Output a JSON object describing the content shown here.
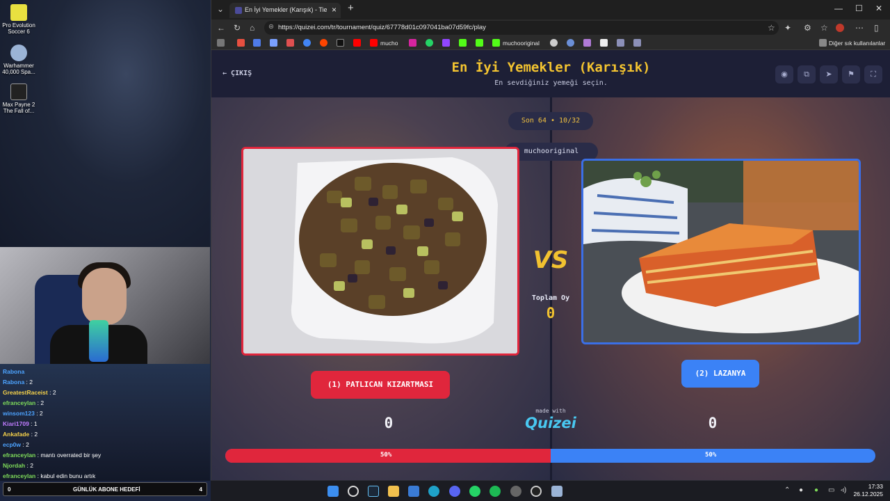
{
  "desktop": {
    "icons": [
      {
        "label": "Pro Evolution Soccer 6",
        "icon": "pes6-icon"
      },
      {
        "label": "Warhammer 40,000 Spa...",
        "icon": "warhammer-icon"
      },
      {
        "label": "Max Payne 2 The Fall of...",
        "icon": "maxpayne-icon"
      }
    ]
  },
  "chat": {
    "lines": [
      {
        "user": "Rabona",
        "msg": "",
        "color": "#4da3ff"
      },
      {
        "user": "Rabona",
        "msg": " : 2",
        "color": "#4da3ff"
      },
      {
        "user": "GreatestRaceist",
        "msg": " : 2",
        "color": "#f5d14a"
      },
      {
        "user": "efranceylan",
        "msg": " : 2",
        "color": "#7fdc5a"
      },
      {
        "user": "winsom123",
        "msg": " : 2",
        "color": "#4da3ff"
      },
      {
        "user": "Kiari1709",
        "msg": " : 1",
        "color": "#c07cff"
      },
      {
        "user": "Ankafade",
        "msg": " : 2",
        "color": "#f5d14a"
      },
      {
        "user": "ecp0w",
        "msg": " : 2",
        "color": "#4da3ff"
      },
      {
        "user": "efranceylan",
        "msg": " : mantı overrated bir şey",
        "color": "#7fdc5a"
      },
      {
        "user": "Njordah",
        "msg": " : 2",
        "color": "#7fdc5a"
      },
      {
        "user": "efranceylan",
        "msg": " : kabul edin bunu artık",
        "color": "#7fdc5a"
      }
    ],
    "goal": {
      "left": "0",
      "label": "GÜNLÜK ABONE HEDEFİ",
      "right": "4"
    }
  },
  "browser": {
    "tab_title": "En İyi Yemekler (Karışık) - Tier List",
    "url": "https://quizei.com/tr/tournament/quiz/67778d01c097041ba07d59fc/play",
    "bookmarks": {
      "mucho": "mucho",
      "muchooriginal": "muchooriginal",
      "other": "Diğer sık kullanılanlar"
    }
  },
  "quiz": {
    "back": "ÇIKIŞ",
    "title": "En İyi Yemekler (Karışık)",
    "subtitle": "En sevdiğiniz yemeği seçin.",
    "round": "Son 64 • 10/32",
    "user": "muchooriginal",
    "vs": "VS",
    "total_label": "Toplam Oy",
    "total_value": "0",
    "left": {
      "label": "(1) PATLICAN KIZARTMASI",
      "score": "0",
      "percent_label": "50%",
      "percent": 0.5,
      "color": "#e0263c"
    },
    "right": {
      "label": "(2) LAZANYA",
      "score": "0",
      "percent_label": "50%",
      "percent": 0.5,
      "color": "#3b82f6"
    },
    "made_with": "made with",
    "logo": "Quizei"
  },
  "taskbar": {
    "time": "17:33",
    "date": "26.12.2025"
  }
}
